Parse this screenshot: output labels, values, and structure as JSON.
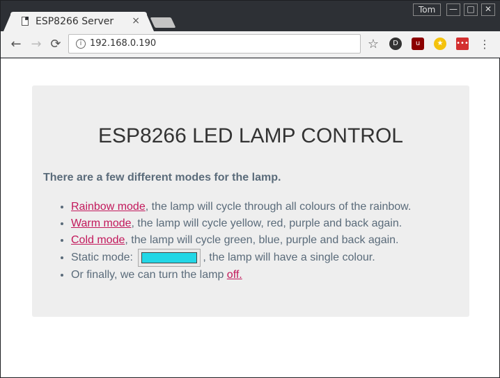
{
  "browser": {
    "tab_title": "ESP8266 Server",
    "tab_close": "×",
    "user_name": "Tom",
    "window_controls": [
      "—",
      "□",
      "✕"
    ],
    "url": "192.168.0.190",
    "nav": {
      "back": "←",
      "forward": "→",
      "reload": "⟳"
    },
    "icons": [
      "star-icon",
      "extension-icon",
      "ublock-icon",
      "smiley-extension-icon",
      "lastpass-icon",
      "menu-icon"
    ]
  },
  "page": {
    "heading": "ESP8266 LED LAMP CONTROL",
    "intro": "There are a few different modes for the lamp.",
    "modes": [
      {
        "link": "Rainbow mode",
        "text": ", the lamp will cycle through all colours of the rainbow."
      },
      {
        "link": "Warm mode",
        "text": ", the lamp will cycle yellow, red, purple and back again."
      },
      {
        "link": "Cold mode",
        "text": ", the lamp will cycle green, blue, purple and back again."
      },
      {
        "label": "Static mode:",
        "text": ", the lamp will have a single colour.",
        "color": "#22d7e6"
      },
      {
        "text": "Or finally, we can turn the lamp ",
        "link": "off."
      }
    ]
  }
}
